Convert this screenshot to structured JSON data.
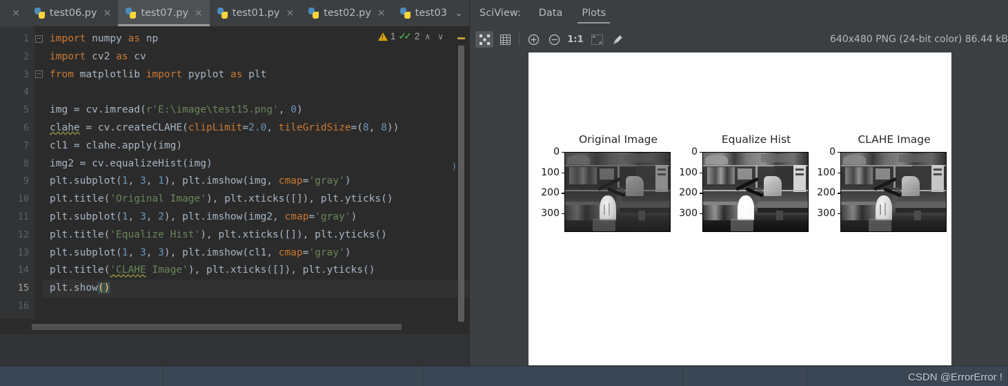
{
  "editor": {
    "tabs": [
      {
        "label": "",
        "icon": "python-file-icon",
        "close": "×",
        "partial": true,
        "active": false
      },
      {
        "label": "test06.py",
        "icon": "python-file-icon",
        "close": "×",
        "active": false
      },
      {
        "label": "test07.py",
        "icon": "python-file-icon",
        "close": "×",
        "active": true
      },
      {
        "label": "test01.py",
        "icon": "python-file-icon",
        "close": "×",
        "active": false
      },
      {
        "label": "test02.py",
        "icon": "python-file-icon",
        "close": "×",
        "active": false
      },
      {
        "label": "test03",
        "icon": "python-file-icon",
        "chevron": "⌄",
        "active": false
      }
    ],
    "inspections": {
      "warning_count": "1",
      "ok_count": "2",
      "prev_label": "∧",
      "next_label": "∨",
      "warning_color": "#d9a404",
      "ok_color": "#5ac35a"
    },
    "line_numbers": [
      "1",
      "2",
      "3",
      "4",
      "5",
      "6",
      "7",
      "8",
      "9",
      "10",
      "11",
      "12",
      "13",
      "14",
      "15",
      "16"
    ],
    "current_line": "15",
    "code_lines": [
      "import numpy as np",
      "import cv2 as cv",
      "from matplotlib import pyplot as plt",
      "",
      "img = cv.imread(r'E:\\image\\test15.png', 0)",
      "clahe = cv.createCLAHE(clipLimit=2.0, tileGridSize=(8, 8))",
      "cl1 = clahe.apply(img)",
      "img2 = cv.equalizeHist(img)",
      "plt.subplot(1, 3, 1), plt.imshow(img, cmap='gray')",
      "plt.title('Original Image'), plt.xticks([]), plt.yticks()",
      "plt.subplot(1, 3, 2), plt.imshow(img2, cmap='gray')",
      "plt.title('Equalize Hist'), plt.xticks([]), plt.yticks()",
      "plt.subplot(1, 3, 3), plt.imshow(cl1, cmap='gray')",
      "plt.title('CLAHE Image'), plt.xticks([]), plt.yticks()",
      "plt.show()",
      ""
    ]
  },
  "sciview": {
    "label": "SciView:",
    "tabs": [
      {
        "label": "Data",
        "active": false
      },
      {
        "label": "Plots",
        "active": true
      }
    ],
    "toolbar": [
      {
        "name": "fit-content-icon",
        "glyph": "∷",
        "selected": true
      },
      {
        "name": "grid-icon",
        "glyph": "⊞",
        "selected": false
      },
      {
        "name": "zoom-in-icon",
        "glyph": "⊕",
        "selected": false
      },
      {
        "name": "zoom-out-icon",
        "glyph": "⊖",
        "selected": false
      },
      {
        "name": "actual-size-label",
        "glyph": "1:1",
        "selected": false
      },
      {
        "name": "fit-window-icon",
        "glyph": "⛶",
        "selected": false
      },
      {
        "name": "color-picker-icon",
        "glyph": "✐",
        "selected": false
      }
    ],
    "image_info": "640x480 PNG (24-bit color) 86.44 kB"
  },
  "chart_data": {
    "type": "heatmap",
    "title": "",
    "layout": "1 row × 3 columns of grayscale images",
    "subplots": [
      {
        "title": "Original Image",
        "xticks": [],
        "ytick_labels": [
          "0",
          "100",
          "200",
          "300"
        ],
        "ytick_values": [
          0,
          100,
          200,
          300
        ],
        "ylim": [
          384,
          0
        ],
        "xlim": [
          0,
          512
        ],
        "cmap": "gray",
        "description": "Low-contrast grayscale photo of a cluttered lab desk with a bust/head sculpture, desk lamp and camera rig in front of shelves"
      },
      {
        "title": "Equalize Hist",
        "xticks": [],
        "ytick_labels": [
          "0",
          "100",
          "200",
          "300"
        ],
        "ytick_values": [
          0,
          100,
          200,
          300
        ],
        "ylim": [
          384,
          0
        ],
        "xlim": [
          0,
          512
        ],
        "cmap": "gray",
        "description": "Same scene after global histogram equalization: higher global contrast, blown highlights on the bust"
      },
      {
        "title": "CLAHE Image",
        "xticks": [],
        "ytick_labels": [
          "0",
          "100",
          "200",
          "300"
        ],
        "ytick_values": [
          0,
          100,
          200,
          300
        ],
        "ylim": [
          384,
          0
        ],
        "xlim": [
          0,
          512
        ],
        "cmap": "gray",
        "description": "Same scene after contrast limited adaptive histogram equalization: locally enhanced detail, preserved highlights"
      }
    ]
  },
  "watermark": "CSDN @ErrorError !",
  "colors": {
    "ide_chrome": "#3c3f41",
    "editor_bg": "#2b2b2b",
    "gutter_bg": "#313335",
    "active_tab": "#4e5254",
    "plot_bg": "#ffffff",
    "taskbar": "#3b4654",
    "keyword": "#cc7832",
    "string": "#6a8759",
    "number": "#6897bb",
    "identifier": "#a9b7c6"
  }
}
